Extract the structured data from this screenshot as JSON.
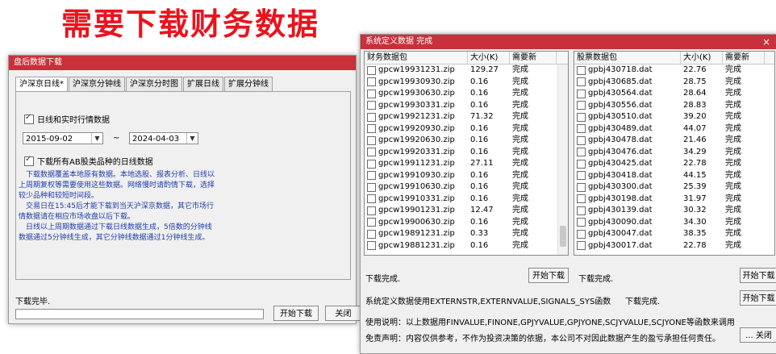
{
  "banner": "需要下载财务数据",
  "left_window": {
    "title": "盘后数据下载",
    "tabs": [
      "沪深京日线*",
      "沪深京分钟线",
      "沪深京分时图",
      "扩展日线",
      "扩展分钟线"
    ],
    "daily_checkbox_label": "日线和实时行情数据",
    "start_date": "2015-09-02",
    "tilde": "~",
    "end_date": "2024-04-03",
    "ab_checkbox_label": "下载所有AB股类品种的日线数据",
    "description": [
      "　下载数据覆盖本地原有数据。本地选股、报表分析、日线以上周期复权等需要使用这些数据。网络慢时请酌情下载，选择较少品种和较短时间段。",
      "　交易日在15:45后才能下载到当天沪深京数据，其它市场行情数据请在相应市场收盘以后下载。",
      "　日线以上周期数据通过下载日线数据生成，5倍数的分钟线数据通过5分钟线生成，其它分钟线数据通过1分钟线生成。"
    ],
    "status": "下载完毕.",
    "start_button": "开始下载",
    "close_button": "关闭"
  },
  "right_window": {
    "title": "系统定义数据 完成",
    "close_icon": "×",
    "finance_list": {
      "headers": [
        "财务数据包",
        "大小(K)",
        "需要新"
      ],
      "rows": [
        [
          "gpcw19931231.zip",
          "129.27",
          "完成"
        ],
        [
          "gpcw19930930.zip",
          "0.16",
          "完成"
        ],
        [
          "gpcw19930630.zip",
          "0.16",
          "完成"
        ],
        [
          "gpcw19930331.zip",
          "0.16",
          "完成"
        ],
        [
          "gpcw19921231.zip",
          "71.32",
          "完成"
        ],
        [
          "gpcw19920930.zip",
          "0.16",
          "完成"
        ],
        [
          "gpcw19920630.zip",
          "0.16",
          "完成"
        ],
        [
          "gpcw19920331.zip",
          "0.16",
          "完成"
        ],
        [
          "gpcw19911231.zip",
          "27.11",
          "完成"
        ],
        [
          "gpcw19910930.zip",
          "0.16",
          "完成"
        ],
        [
          "gpcw19910630.zip",
          "0.16",
          "完成"
        ],
        [
          "gpcw19910331.zip",
          "0.16",
          "完成"
        ],
        [
          "gpcw19901231.zip",
          "12.47",
          "完成"
        ],
        [
          "gpcw19900630.zip",
          "0.16",
          "完成"
        ],
        [
          "gpcw19891231.zip",
          "0.33",
          "完成"
        ],
        [
          "gpcw19881231.zip",
          "0.16",
          "完成"
        ]
      ],
      "status": "下载完成.",
      "start_button": "开始下载"
    },
    "stock_list": {
      "headers": [
        "股票数据包",
        "大小(K)",
        "需要新"
      ],
      "rows": [
        [
          "gpbj430718.dat",
          "22.76",
          "完成"
        ],
        [
          "gpbj430685.dat",
          "28.75",
          "完成"
        ],
        [
          "gpbj430564.dat",
          "28.64",
          "完成"
        ],
        [
          "gpbj430556.dat",
          "28.83",
          "完成"
        ],
        [
          "gpbj430510.dat",
          "39.20",
          "完成"
        ],
        [
          "gpbj430489.dat",
          "44.07",
          "完成"
        ],
        [
          "gpbj430478.dat",
          "21.46",
          "完成"
        ],
        [
          "gpbj430476.dat",
          "34.29",
          "完成"
        ],
        [
          "gpbj430425.dat",
          "22.78",
          "完成"
        ],
        [
          "gpbj430418.dat",
          "44.15",
          "完成"
        ],
        [
          "gpbj430300.dat",
          "25.39",
          "完成"
        ],
        [
          "gpbj430198.dat",
          "31.97",
          "完成"
        ],
        [
          "gpbj430139.dat",
          "30.32",
          "完成"
        ],
        [
          "gpbj430090.dat",
          "34.30",
          "完成"
        ],
        [
          "gpbj430047.dat",
          "38.35",
          "完成"
        ],
        [
          "gpbj430017.dat",
          "22.78",
          "完成"
        ]
      ],
      "status": "下载完成.",
      "start_button": "开始下载"
    },
    "sys_note": "系统定义数据使用EXTERNSTR,EXTERNVALUE,SIGNALS_SYS函数",
    "sys_status": "下载完成.",
    "sys_start_button": "开始下载",
    "usage_note": "使用说明：以上数据用FINVALUE,FINONE,GPJYVALUE,GPJYONE,SCJYVALUE,SCJYONE等函数来调用",
    "disclaimer": "免责声明：内容仅供参考，不作为投资决策的依据，本公司不对因此数据产生的盈亏承担任何责任。",
    "close_button": "... 关闭"
  }
}
